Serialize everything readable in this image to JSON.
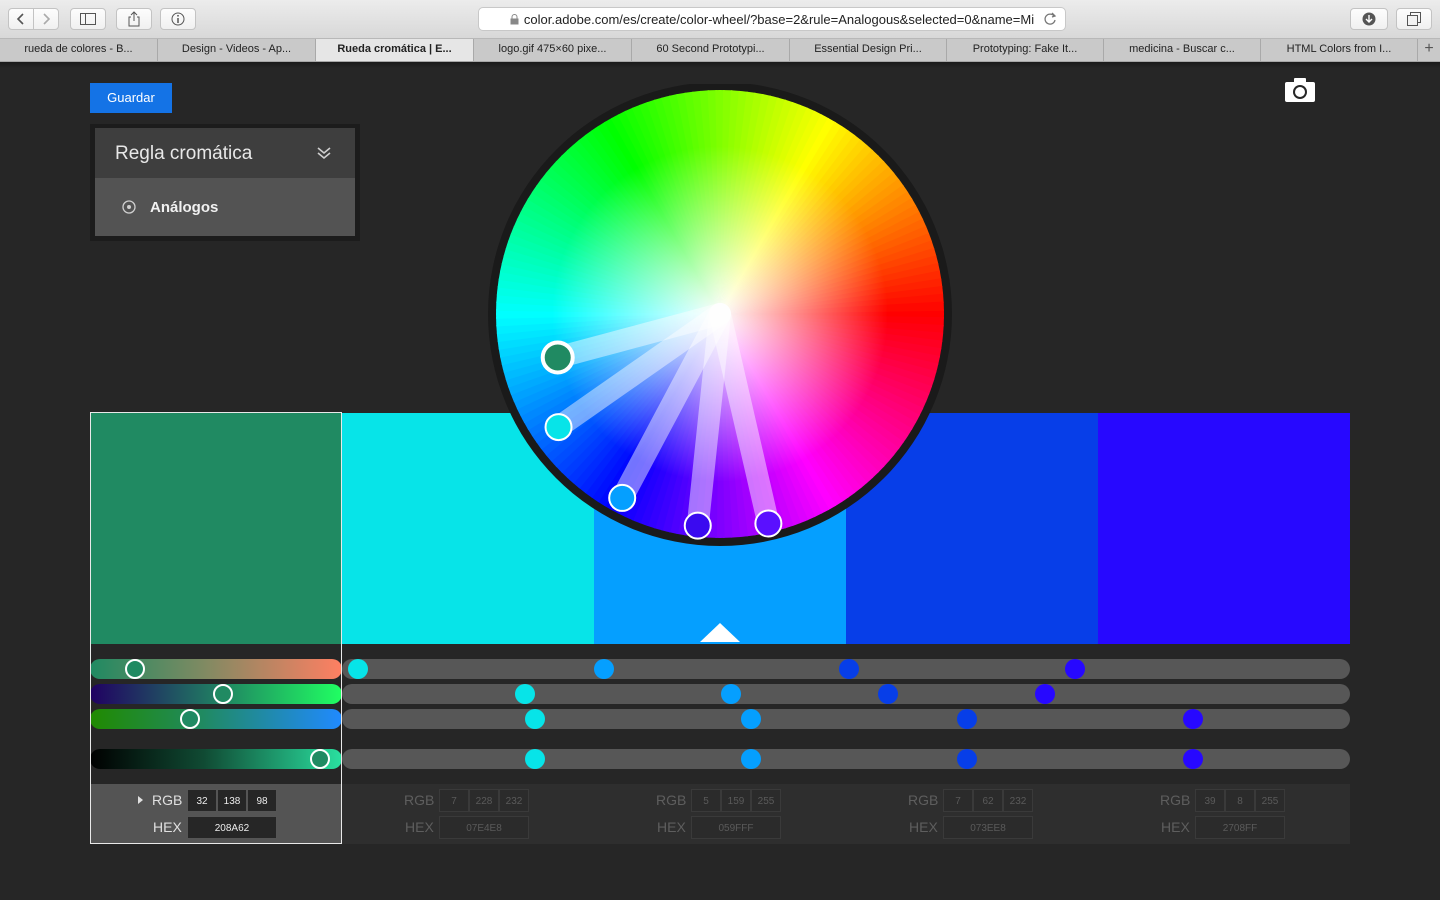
{
  "browser": {
    "url": "color.adobe.com/es/create/color-wheel/?base=2&rule=Analogous&selected=0&name=Mi",
    "tabs": [
      {
        "label": "rueda de colores - B...",
        "active": false
      },
      {
        "label": "Design - Videos - Ap...",
        "active": false
      },
      {
        "label": "Rueda cromática | E...",
        "active": true
      },
      {
        "label": "logo.gif 475×60 pixe...",
        "active": false
      },
      {
        "label": "60 Second Prototypi...",
        "active": false
      },
      {
        "label": "Essential Design Pri...",
        "active": false
      },
      {
        "label": "Prototyping: Fake It...",
        "active": false
      },
      {
        "label": "medicina - Buscar c...",
        "active": false
      },
      {
        "label": "HTML Colors from I...",
        "active": false
      }
    ],
    "new_tab": "+"
  },
  "app": {
    "save_label": "Guardar",
    "rule_title": "Regla cromática",
    "rule_option": "Análogos",
    "accent": "#1473e6"
  },
  "swatches": [
    {
      "hex_color": "#208a62",
      "rgb": [
        "32",
        "138",
        "98"
      ],
      "hex": "208A62",
      "selected": true
    },
    {
      "hex_color": "#07e4e8",
      "rgb": [
        "7",
        "228",
        "232"
      ],
      "hex": "07E4E8",
      "selected": false
    },
    {
      "hex_color": "#059fff",
      "rgb": [
        "5",
        "159",
        "255"
      ],
      "hex": "059FFF",
      "selected": false
    },
    {
      "hex_color": "#073ee8",
      "rgb": [
        "7",
        "62",
        "232"
      ],
      "hex": "073EE8",
      "selected": false
    },
    {
      "hex_color": "#2708ff",
      "rgb": [
        "39",
        "8",
        "255"
      ],
      "hex": "2708FF",
      "selected": false
    }
  ],
  "labels": {
    "rgb": "RGB",
    "hex": "HEX"
  },
  "sliders": {
    "selected_values": [
      0.15,
      0.53,
      0.39,
      0.95
    ],
    "other_values": [
      [
        0.0,
        0.25,
        0.5,
        0.73
      ],
      [
        0.17,
        0.38,
        0.54,
        0.7
      ],
      [
        0.18,
        0.4,
        0.62,
        0.85
      ],
      [
        0.18,
        0.4,
        0.62,
        0.85
      ]
    ]
  },
  "wheel": {
    "handles": [
      {
        "color": "#208a62",
        "selected": true
      },
      {
        "color": "#07e4e8",
        "selected": false
      },
      {
        "color": "#059fff",
        "selected": false
      },
      {
        "color": "#3a0af0",
        "selected": false
      },
      {
        "color": "#5a10ff",
        "selected": false
      }
    ]
  }
}
